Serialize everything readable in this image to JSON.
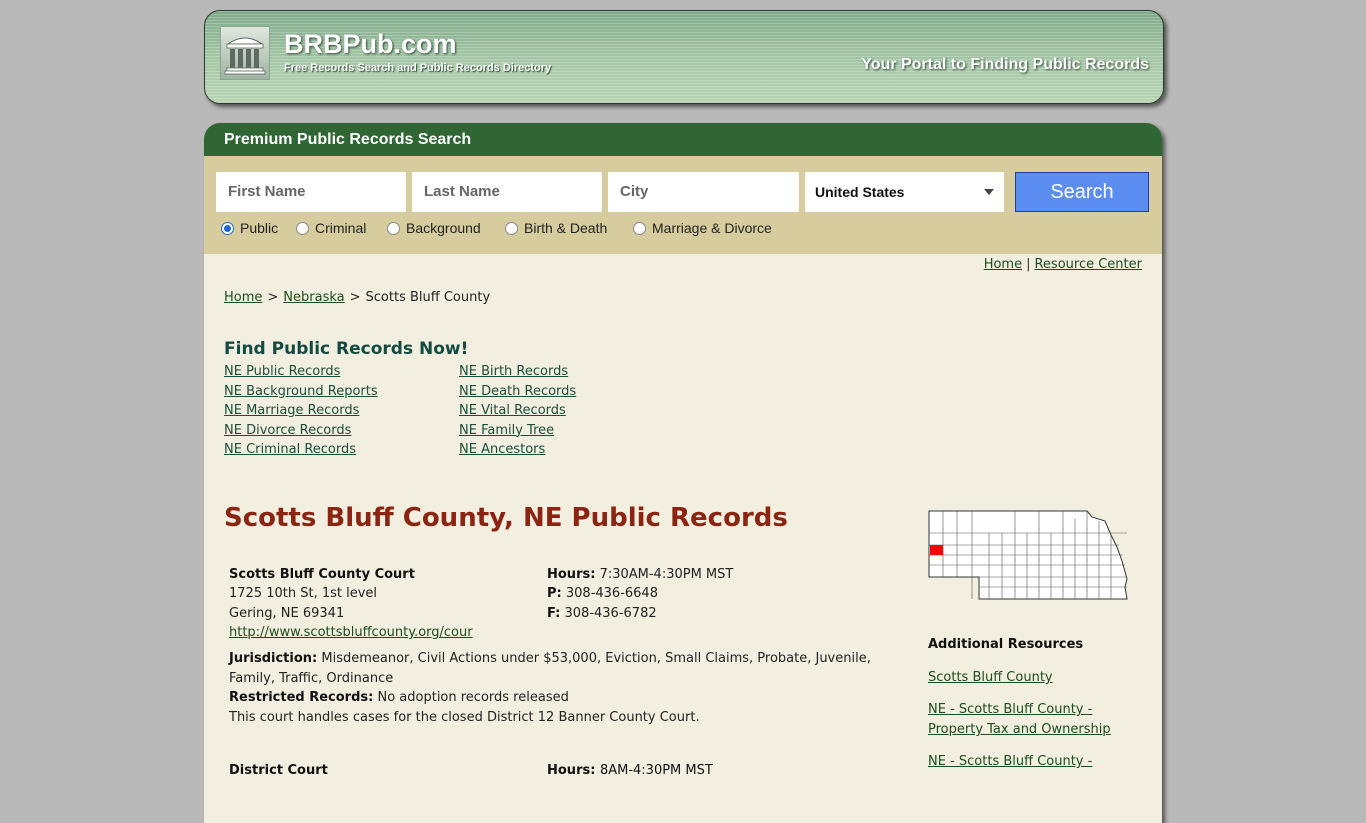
{
  "header": {
    "brand": "BRBPub.com",
    "subtitle": "Free Records Search and Public Records Directory",
    "tagline": "Your Portal to Finding Public Records",
    "logo_icon": "courthouse-icon"
  },
  "search": {
    "title": "Premium Public Records Search",
    "first_name_placeholder": "First Name",
    "last_name_placeholder": "Last Name",
    "city_placeholder": "City",
    "country_selected": "United States",
    "button_label": "Search",
    "record_types": [
      {
        "label": "Public",
        "selected": true
      },
      {
        "label": "Criminal",
        "selected": false
      },
      {
        "label": "Background",
        "selected": false
      },
      {
        "label": "Birth & Death",
        "selected": false
      },
      {
        "label": "Marriage & Divorce",
        "selected": false
      }
    ]
  },
  "top_links": {
    "home": "Home",
    "separator": "|",
    "resource_center": "Resource Center"
  },
  "breadcrumb": {
    "items": [
      "Home",
      "Nebraska",
      "Scotts Bluff County"
    ],
    "separator": ">"
  },
  "find_records": {
    "title": "Find Public Records Now!",
    "column1": [
      "NE Public Records",
      "NE Background Reports",
      "NE Marriage Records",
      "NE Divorce Records",
      "NE Criminal Records"
    ],
    "column2": [
      "NE Birth Records",
      "NE Death Records",
      "NE Vital Records",
      "NE Family Tree",
      "NE Ancestors"
    ]
  },
  "page_title": "Scotts Bluff County, NE Public Records",
  "court": {
    "name": "Scotts Bluff County Court",
    "address1": "1725 10th St, 1st level",
    "address2": "Gering, NE 69341",
    "url": "http://www.scottsbluffcounty.org/cour",
    "hours_label": "Hours:",
    "hours": "7:30AM-4:30PM MST",
    "phone_label": "P:",
    "phone": "308-436-6648",
    "fax_label": "F:",
    "fax": "308-436-6782",
    "jurisdiction_label": "Jurisdiction:",
    "jurisdiction": "Misdemeanor, Civil Actions under $53,000, Eviction, Small Claims, Probate, Juvenile, Family, Traffic, Ordinance",
    "restricted_label": "Restricted Records:",
    "restricted": "No adoption records released",
    "note": "This court handles cases for the closed District 12 Banner County Court."
  },
  "next_court": {
    "name": "District Court",
    "hours_label": "Hours:",
    "hours": "8AM-4:30PM MST"
  },
  "map": {
    "state": "Nebraska",
    "highlighted_county": "Scotts Bluff County",
    "highlight_color": "#ff0000"
  },
  "additional_resources": {
    "title": "Additional Resources",
    "links": [
      "Scotts Bluff County",
      "NE - Scotts Bluff County - Property Tax and Ownership",
      "NE - Scotts Bluff County -"
    ]
  }
}
